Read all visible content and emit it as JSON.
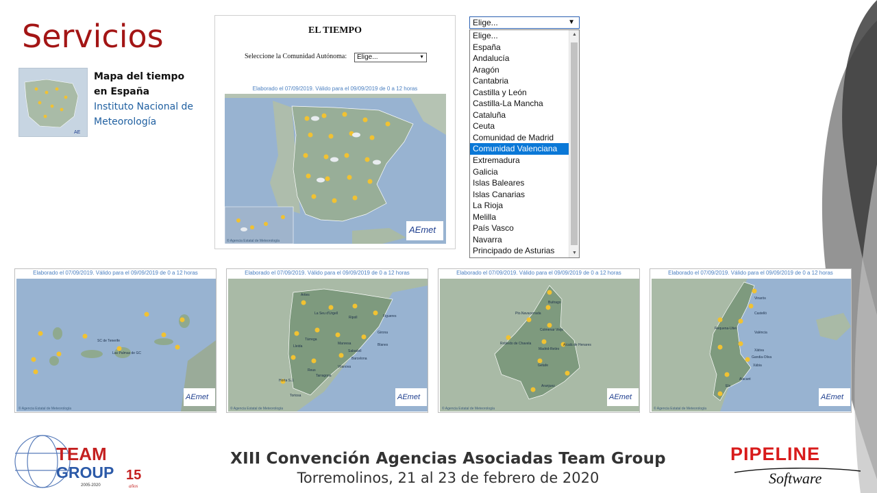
{
  "slide": {
    "title": "Servicios"
  },
  "service": {
    "name": "Mapa del tiempo en España",
    "provider": "Instituto Nacional de Meteorología"
  },
  "panel": {
    "heading": "EL TIEMPO",
    "select_label": "Seleccione la Comunidad Autónoma:",
    "select_value": "Elige...",
    "caption": "Elaborado el 07/09/2019. Válido para el 09/09/2019 de 0 a 12 horas",
    "map_logo": "AEmet",
    "map_credit": "© Agencia Estatal de Meteorología"
  },
  "dropdown": {
    "value": "Elige...",
    "options": [
      "Elige...",
      "España",
      "Andalucía",
      "Aragón",
      "Cantabria",
      "Castilla y León",
      "Castilla-La Mancha",
      "Cataluña",
      "Ceuta",
      "Comunidad de Madrid",
      "Comunidad Valenciana",
      "Extremadura",
      "Galicia",
      "Islas Baleares",
      "Islas Canarias",
      "La Rioja",
      "Melilla",
      "País Vasco",
      "Navarra",
      "Principado de Asturias"
    ],
    "highlighted": "Comunidad Valenciana"
  },
  "regional_maps": [
    {
      "caption": "Elaborado el 07/09/2019. Válido para el 09/09/2019 de 0 a 12 horas",
      "logo": "AEmet",
      "credit": "© Agencia Estatal de Meteorología",
      "places": [
        "SC de Tenerife",
        "Las Palmas de GC"
      ]
    },
    {
      "caption": "Elaborado el 07/09/2019. Válido para el 09/09/2019 de 0 a 12 horas",
      "logo": "AEmet",
      "credit": "© Agencia Estatal de Meteorología",
      "places": [
        "Arties",
        "La Seu d'Urgell",
        "Ripoll",
        "Figueres",
        "Girona",
        "Tàrrega",
        "Manresa",
        "Blanes",
        "Lleida",
        "Sabadell",
        "Barcelona",
        "Vilanova",
        "Reus",
        "Tarragona",
        "Horta S.J.",
        "Tortosa"
      ]
    },
    {
      "caption": "Elaborado el 07/09/2019. Válido para el 09/09/2019 de 0 a 12 horas",
      "logo": "AEmet",
      "credit": "© Agencia Estatal de Meteorología",
      "places": [
        "Buitrago",
        "Pto.Navacerrada",
        "Colmenar Viejo",
        "Robledo de Chavela",
        "Madrid-Retiro",
        "Alcalá de Henares",
        "Getafe",
        "Aranjuez"
      ]
    },
    {
      "caption": "Elaborado el 07/09/2019. Válido para el 09/09/2019 de 0 a 12 horas",
      "logo": "AEmet",
      "credit": "© Agencia Estatal de Meteorología",
      "places": [
        "Vinaròs",
        "Castelló",
        "Requena-Utiel",
        "València",
        "Xàtiva",
        "Gandia-Oliva",
        "Xàbia",
        "Alacant",
        "Elx"
      ]
    }
  ],
  "footer": {
    "title": "XIII Convención Agencias Asociadas Team Group",
    "subtitle": "Torremolinos, 21 al 23 de febrero de 2020"
  },
  "logos": {
    "team_group": {
      "line1": "TEAM",
      "line2": "GROUP",
      "years": "15",
      "years_word": "años",
      "range": "2005-2020"
    },
    "pipeline": {
      "name": "PIPELINE",
      "tagline": "Software"
    }
  },
  "colors": {
    "title_red": "#a31515",
    "link_blue": "#1f5fa0",
    "sea": "#98b3d1",
    "land": "#a7b9a7",
    "region": "#7e9a7e",
    "selection": "#0a78d7"
  }
}
